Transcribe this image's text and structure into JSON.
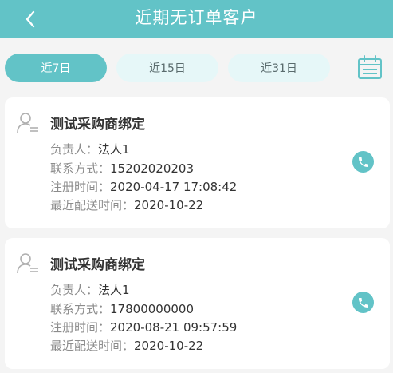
{
  "header": {
    "title": "近期无订单客户",
    "back_icon": "chevron-left-icon"
  },
  "filters": {
    "tabs": [
      {
        "label": "近7日",
        "active": true
      },
      {
        "label": "近15日",
        "active": false
      },
      {
        "label": "近31日",
        "active": false
      }
    ],
    "calendar_icon": "calendar-icon"
  },
  "colors": {
    "accent": "#62c3c7",
    "tab_inactive_bg": "#e6f7f8",
    "page_bg": "#f4f4f4"
  },
  "customers": [
    {
      "name": "测试采购商绑定",
      "owner_label": "负责人：",
      "owner": "法人1",
      "contact_label": "联系方式：",
      "contact": "15202020203",
      "register_label": "注册时间：",
      "register_time": "2020-04-17 17:08:42",
      "delivery_label": "最近配送时间：",
      "delivery_time": "2020-10-22"
    },
    {
      "name": "测试采购商绑定",
      "owner_label": "负责人：",
      "owner": "法人1",
      "contact_label": "联系方式：",
      "contact": "17800000000",
      "register_label": "注册时间：",
      "register_time": "2020-08-21 09:57:59",
      "delivery_label": "最近配送时间：",
      "delivery_time": "2020-10-22"
    }
  ]
}
